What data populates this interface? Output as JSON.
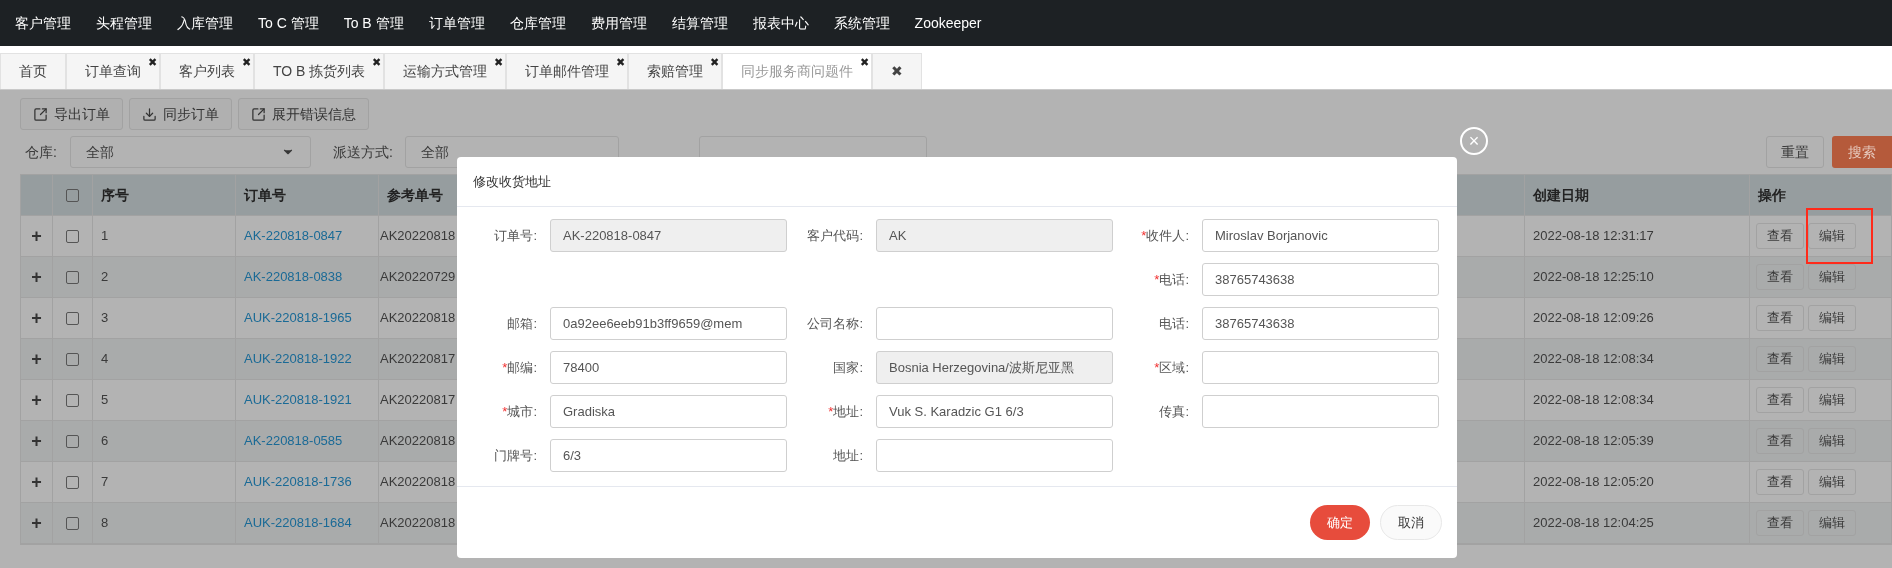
{
  "nav": [
    "客户管理",
    "头程管理",
    "入库管理",
    "To C 管理",
    "To B 管理",
    "订单管理",
    "仓库管理",
    "费用管理",
    "结算管理",
    "报表中心",
    "系统管理",
    "Zookeeper"
  ],
  "tabs": [
    {
      "label": "首页",
      "selected": false
    },
    {
      "label": "订单查询",
      "close": "✖",
      "selected": false
    },
    {
      "label": "客户列表",
      "close": "✖",
      "selected": false
    },
    {
      "label": "TO B 拣货列表",
      "close": "✖",
      "selected": false
    },
    {
      "label": "运输方式管理",
      "close": "✖",
      "selected": false
    },
    {
      "label": "订单邮件管理",
      "close": "✖",
      "selected": false
    },
    {
      "label": "索赔管理",
      "close": "✖",
      "selected": false
    },
    {
      "label": "同步服务商问题件",
      "close": "✖",
      "selected": true
    },
    {
      "label": "✖",
      "selected": false
    }
  ],
  "toolbar": [
    {
      "label": "导出订单",
      "kind": "export"
    },
    {
      "label": "同步订单",
      "kind": "download"
    },
    {
      "label": "展开错误信息",
      "kind": "export"
    }
  ],
  "filters": {
    "warehouse_label": "仓库:",
    "warehouse_value": "全部",
    "delivery_label": "派送方式:",
    "delivery_value": "全部",
    "reset": "重置",
    "search": "搜索"
  },
  "table": {
    "columns": [
      "序号",
      "订单号",
      "参考单号",
      "创建日期",
      "操作"
    ],
    "all_checked": false,
    "rows": [
      {
        "expand": "+",
        "checked": false,
        "seq": "1",
        "order": "AK-220818-0847",
        "ref": "AK20220818",
        "date": "2022-08-18 12:31:17",
        "view": "查看",
        "edit": "编辑",
        "highlighted": true
      },
      {
        "expand": "+",
        "checked": false,
        "seq": "2",
        "order": "AK-220818-0838",
        "ref": "AK20220729",
        "date": "2022-08-18 12:25:10",
        "view": "查看",
        "edit": "编辑",
        "highlighted": false
      },
      {
        "expand": "+",
        "checked": false,
        "seq": "3",
        "order": "AUK-220818-1965",
        "ref": "AK20220818",
        "date": "2022-08-18 12:09:26",
        "view": "查看",
        "edit": "编辑",
        "highlighted": false
      },
      {
        "expand": "+",
        "checked": false,
        "seq": "4",
        "order": "AUK-220818-1922",
        "ref": "AK20220817",
        "date": "2022-08-18 12:08:34",
        "view": "查看",
        "edit": "编辑",
        "highlighted": false
      },
      {
        "expand": "+",
        "checked": false,
        "seq": "5",
        "order": "AUK-220818-1921",
        "ref": "AK20220817",
        "date": "2022-08-18 12:08:34",
        "view": "查看",
        "edit": "编辑",
        "highlighted": false
      },
      {
        "expand": "+",
        "checked": false,
        "seq": "6",
        "order": "AK-220818-0585",
        "ref": "AK20220818",
        "date": "2022-08-18 12:05:39",
        "view": "查看",
        "edit": "编辑",
        "highlighted": false
      },
      {
        "expand": "+",
        "checked": false,
        "seq": "7",
        "order": "AUK-220818-1736",
        "ref": "AK20220818",
        "date": "2022-08-18 12:05:20",
        "view": "查看",
        "edit": "编辑",
        "highlighted": false
      },
      {
        "expand": "+",
        "checked": false,
        "seq": "8",
        "order": "AUK-220818-1684",
        "ref": "AK20220818",
        "date": "2022-08-18 12:04:25",
        "view": "查看",
        "edit": "编辑",
        "highlighted": false
      }
    ]
  },
  "modal": {
    "title": "修改收货地址",
    "close": "×",
    "rows": [
      [
        {
          "kind": "field",
          "label": "订单号:",
          "readonly": true,
          "value": "AK-220818-0847"
        },
        {
          "kind": "field",
          "label": "客户代码:",
          "readonly": true,
          "value": "AK"
        },
        {
          "kind": "field",
          "marker": "*",
          "label": "收件人:",
          "readonly": false,
          "value": "Miroslav Borjanovic"
        }
      ],
      [
        {
          "kind": "spacer"
        },
        {
          "kind": "spacer"
        },
        {
          "kind": "field",
          "marker": "*",
          "label": "电话:",
          "readonly": false,
          "value": "38765743638"
        }
      ],
      [
        {
          "kind": "field",
          "label": "邮箱:",
          "readonly": false,
          "value": "0a92ee6eeb91b3ff9659@mem"
        },
        {
          "kind": "field",
          "label": "公司名称:",
          "readonly": false
        },
        {
          "kind": "field",
          "label": "电话:",
          "readonly": false,
          "value": "38765743638"
        }
      ],
      [
        {
          "kind": "field",
          "marker": "*",
          "label": "邮编:",
          "readonly": false,
          "value": "78400"
        },
        {
          "kind": "field",
          "label": "国家:",
          "readonly": true,
          "value": "Bosnia Herzegovina/波斯尼亚黑"
        },
        {
          "kind": "field",
          "marker": "*",
          "label": "区域:",
          "readonly": false
        }
      ],
      [
        {
          "kind": "field",
          "marker": "*",
          "label": "城市:",
          "readonly": false,
          "value": "Gradiska"
        },
        {
          "kind": "field",
          "marker": "*",
          "label": "地址:",
          "readonly": false,
          "value": "Vuk S. Karadzic G1 6/3"
        },
        {
          "kind": "field",
          "label": "传真:",
          "readonly": false
        }
      ],
      [
        {
          "kind": "field",
          "label": "门牌号:",
          "readonly": false,
          "value": "6/3"
        },
        {
          "kind": "field",
          "label": "地址:",
          "readonly": false
        },
        {
          "kind": "spacer"
        }
      ]
    ],
    "confirm": "确定",
    "cancel": "取消"
  }
}
